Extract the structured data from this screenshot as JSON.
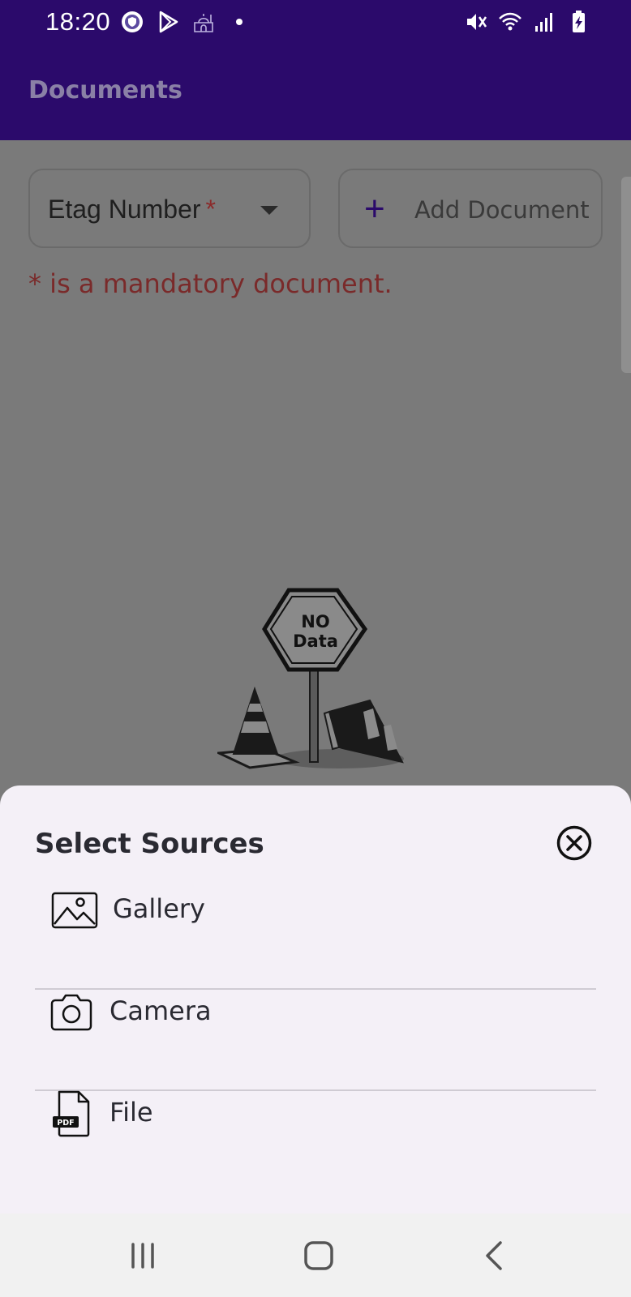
{
  "status_bar": {
    "time": "18:20",
    "left_icons": [
      "shield-app-icon",
      "play-store-icon",
      "mosque-icon",
      "dot-icon"
    ],
    "right_icons": [
      "mute-icon",
      "wifi-icon",
      "signal-icon",
      "battery-charging-icon"
    ]
  },
  "app_bar": {
    "title": "Documents"
  },
  "content": {
    "document_select": {
      "label": "Etag Number",
      "required_marker": "*"
    },
    "add_document": {
      "label": "Add Document"
    },
    "mandatory_note": "* is a mandatory document.",
    "empty_state": {
      "sign_line1": "NO",
      "sign_line2": "Data"
    }
  },
  "sheet": {
    "title": "Select Sources",
    "options": [
      {
        "label": "Gallery",
        "icon": "gallery-icon"
      },
      {
        "label": "Camera",
        "icon": "camera-icon"
      },
      {
        "label": "File",
        "icon": "pdf-file-icon"
      }
    ],
    "file_icon_badge": "PDF"
  },
  "nav_bar": {
    "buttons": [
      "recents-icon",
      "home-icon",
      "back-icon"
    ]
  },
  "colors": {
    "primary": "#2b0a6b",
    "scrim_background": "#7a7a7a",
    "sheet_background": "#f4f0f7",
    "required_red": "#8b2a2a"
  }
}
